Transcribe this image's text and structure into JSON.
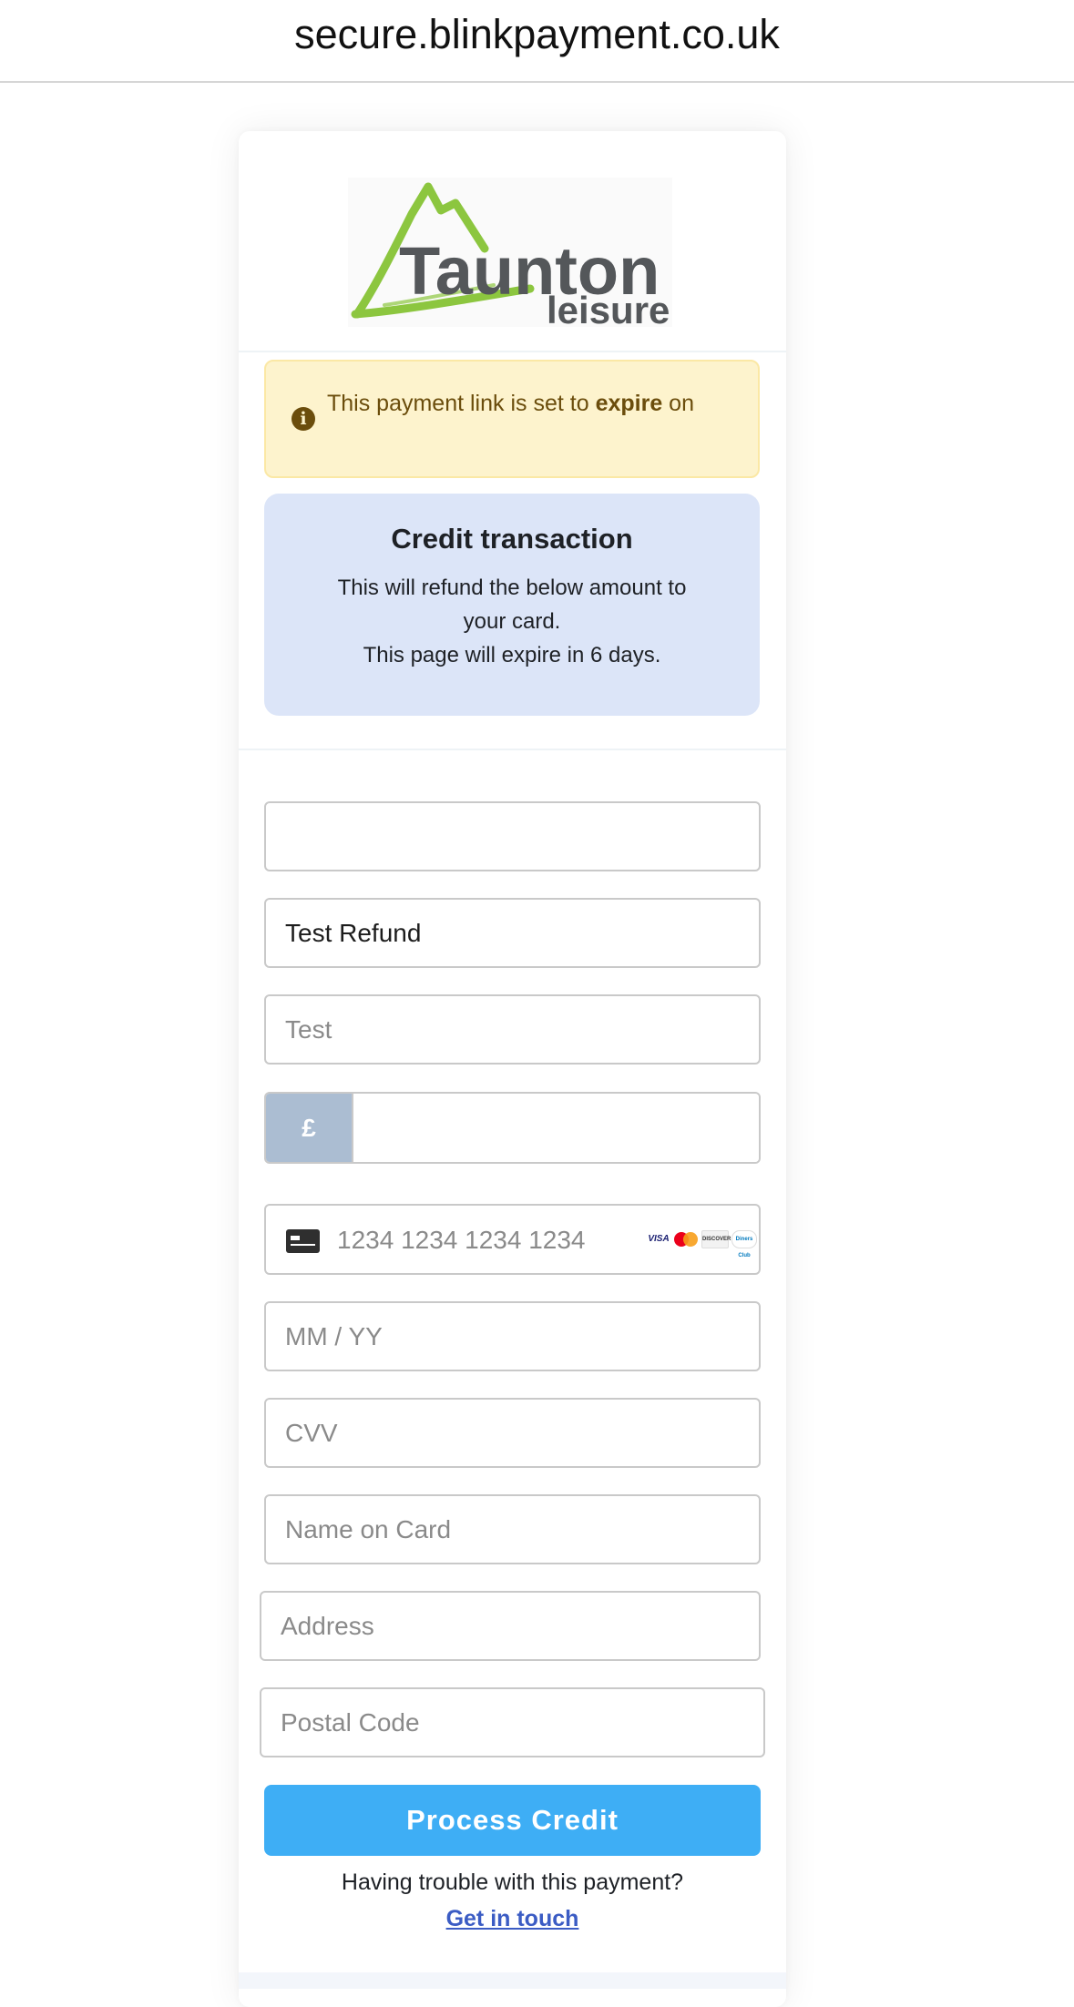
{
  "browser": {
    "url": "secure.blinkpayment.co.uk"
  },
  "brand": {
    "logo_line1": "Taunton",
    "logo_line2": "leisure",
    "logo_colors": {
      "swoosh": "#8cc63f",
      "text": "#54575a"
    }
  },
  "alert": {
    "icon": "info-icon",
    "text_before": "This payment link is set to ",
    "text_bold": "expire",
    "text_after": " on"
  },
  "credit": {
    "title": "Credit transaction",
    "line1": "This will refund the below amount to",
    "line2": "your card.",
    "line3": "This page will expire in 6 days."
  },
  "form": {
    "field1": {
      "value": "",
      "placeholder": ""
    },
    "field2": {
      "value": "Test Refund",
      "placeholder": ""
    },
    "field3": {
      "value": "",
      "placeholder": "Test"
    },
    "amount": {
      "currency_symbol": "£",
      "value": ""
    },
    "card_number": {
      "placeholder": "1234 1234 1234 1234",
      "brands": [
        "VISA",
        "Mastercard",
        "DISCOVER",
        "Diners Club"
      ]
    },
    "expiry": {
      "placeholder": "MM / YY"
    },
    "cvv": {
      "placeholder": "CVV"
    },
    "name_on_card": {
      "placeholder": "Name on Card"
    },
    "address": {
      "placeholder": "Address"
    },
    "postal_code": {
      "placeholder": "Postal Code"
    },
    "submit_label": "Process Credit"
  },
  "footer": {
    "trouble_text": "Having trouble with this payment?",
    "contact_link": "Get in touch"
  },
  "colors": {
    "accent": "#3eaef5",
    "alert_bg": "#fdf3cd",
    "alert_text": "#6b4d0c",
    "credit_bg": "#dce5f8",
    "currency_prefix_bg": "#abbdd2",
    "link": "#3b5cc4"
  }
}
